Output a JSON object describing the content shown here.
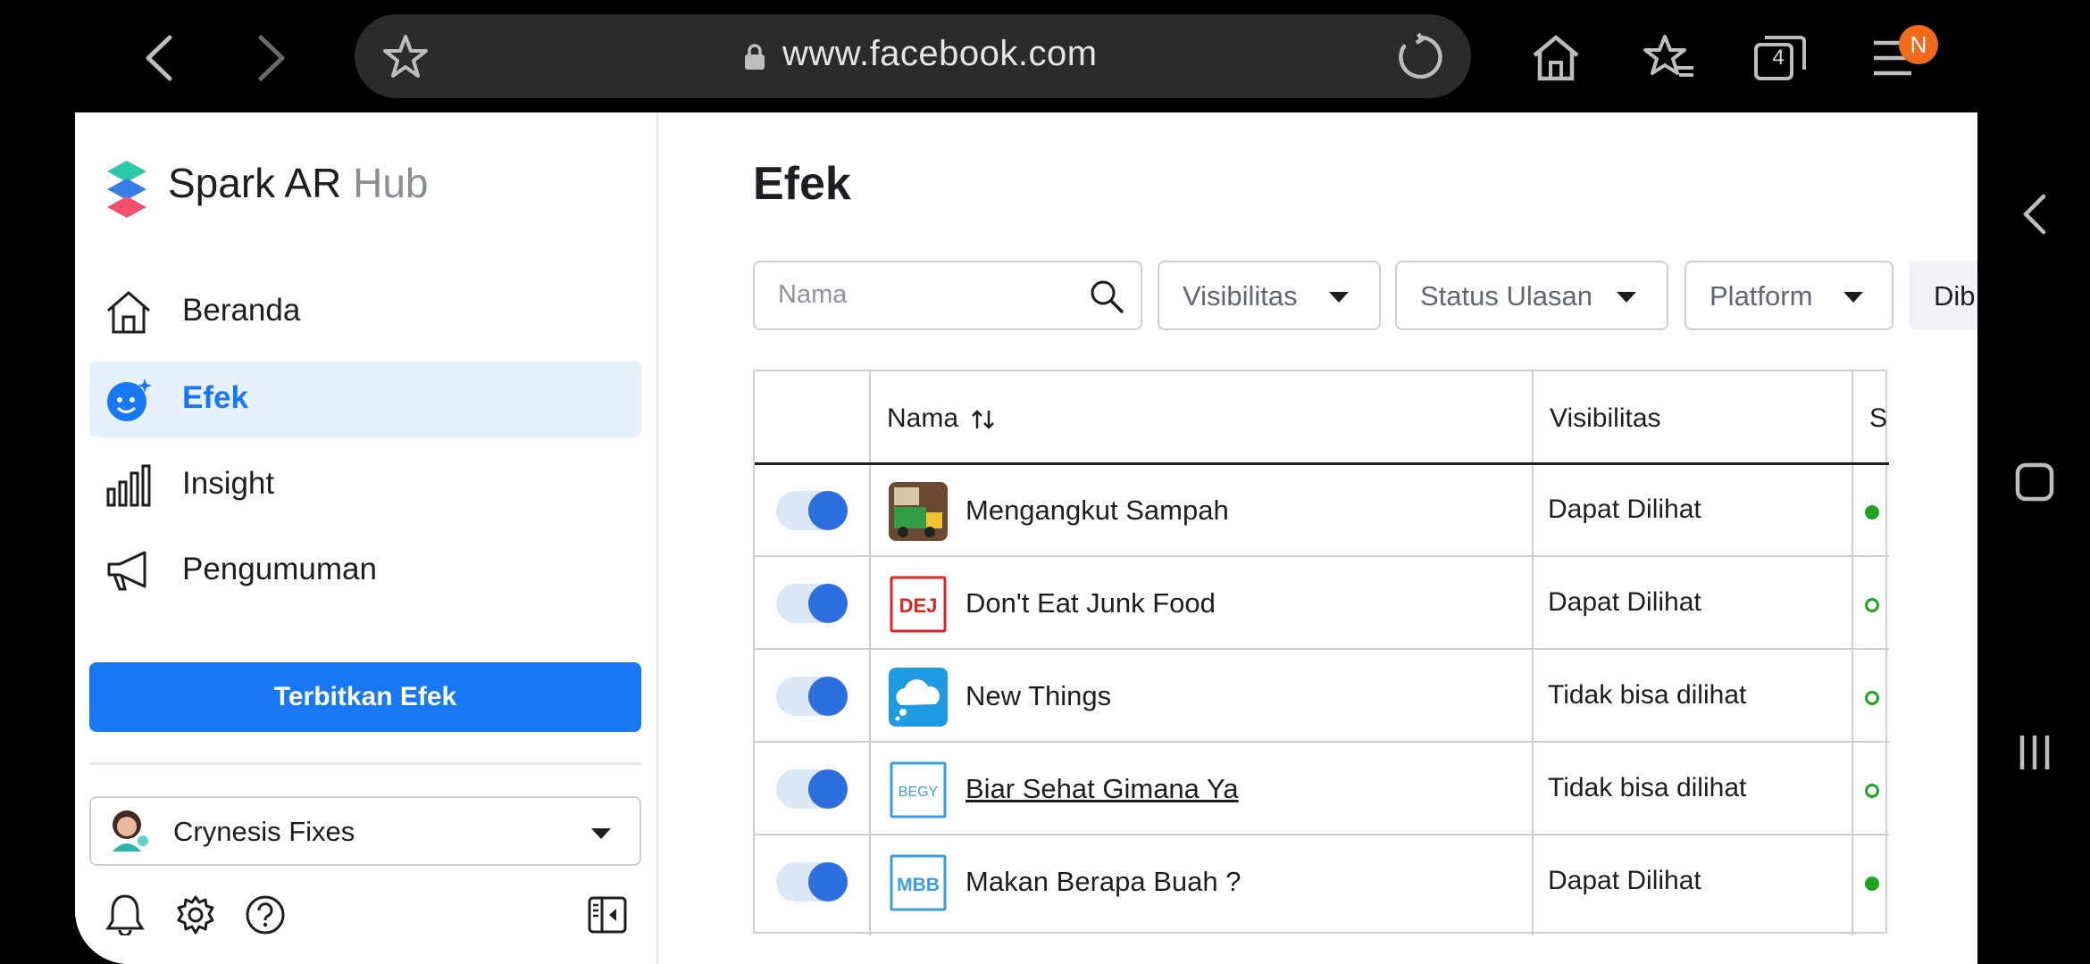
{
  "browser": {
    "url": "www.facebook.com",
    "tab_count": "4",
    "menu_badge": "N"
  },
  "sidebar": {
    "brand_main": "Spark AR ",
    "brand_hub": "Hub",
    "items": [
      {
        "label": "Beranda",
        "icon": "home-icon",
        "active": false
      },
      {
        "label": "Efek",
        "icon": "effects-icon",
        "active": true
      },
      {
        "label": "Insight",
        "icon": "bar-chart-icon",
        "active": false
      },
      {
        "label": "Pengumuman",
        "icon": "megaphone-icon",
        "active": false
      }
    ],
    "publish_label": "Terbitkan Efek",
    "account_name": "Crynesis Fixes"
  },
  "main": {
    "title": "Efek",
    "search_placeholder": "Nama",
    "filters": [
      "Visibilitas",
      "Status Ulasan",
      "Platform",
      "Dib"
    ],
    "columns": [
      "Nama",
      "Visibilitas",
      "S"
    ],
    "rows": [
      {
        "name": "Mengangkut Sampah",
        "visibility": "Dapat Dilihat",
        "thumb": "garbage-truck",
        "status": "filled"
      },
      {
        "name": "Don't Eat Junk Food",
        "visibility": "Dapat Dilihat",
        "thumb": "DEJ",
        "status": "ring"
      },
      {
        "name": "New Things",
        "visibility": "Tidak bisa dilihat",
        "thumb": "cloud",
        "status": "ring"
      },
      {
        "name": "Biar Sehat Gimana Ya",
        "visibility": "Tidak bisa dilihat",
        "thumb": "BEGY",
        "status": "ring"
      },
      {
        "name": "Makan Berapa Buah ?",
        "visibility": "Dapat Dilihat",
        "thumb": "MBB",
        "status": "filled"
      }
    ]
  },
  "colors": {
    "accent": "#1877f2",
    "active_bg": "#e7f0fd",
    "status_green": "#1ea31e",
    "toggle_knob": "#2e6fe0"
  }
}
